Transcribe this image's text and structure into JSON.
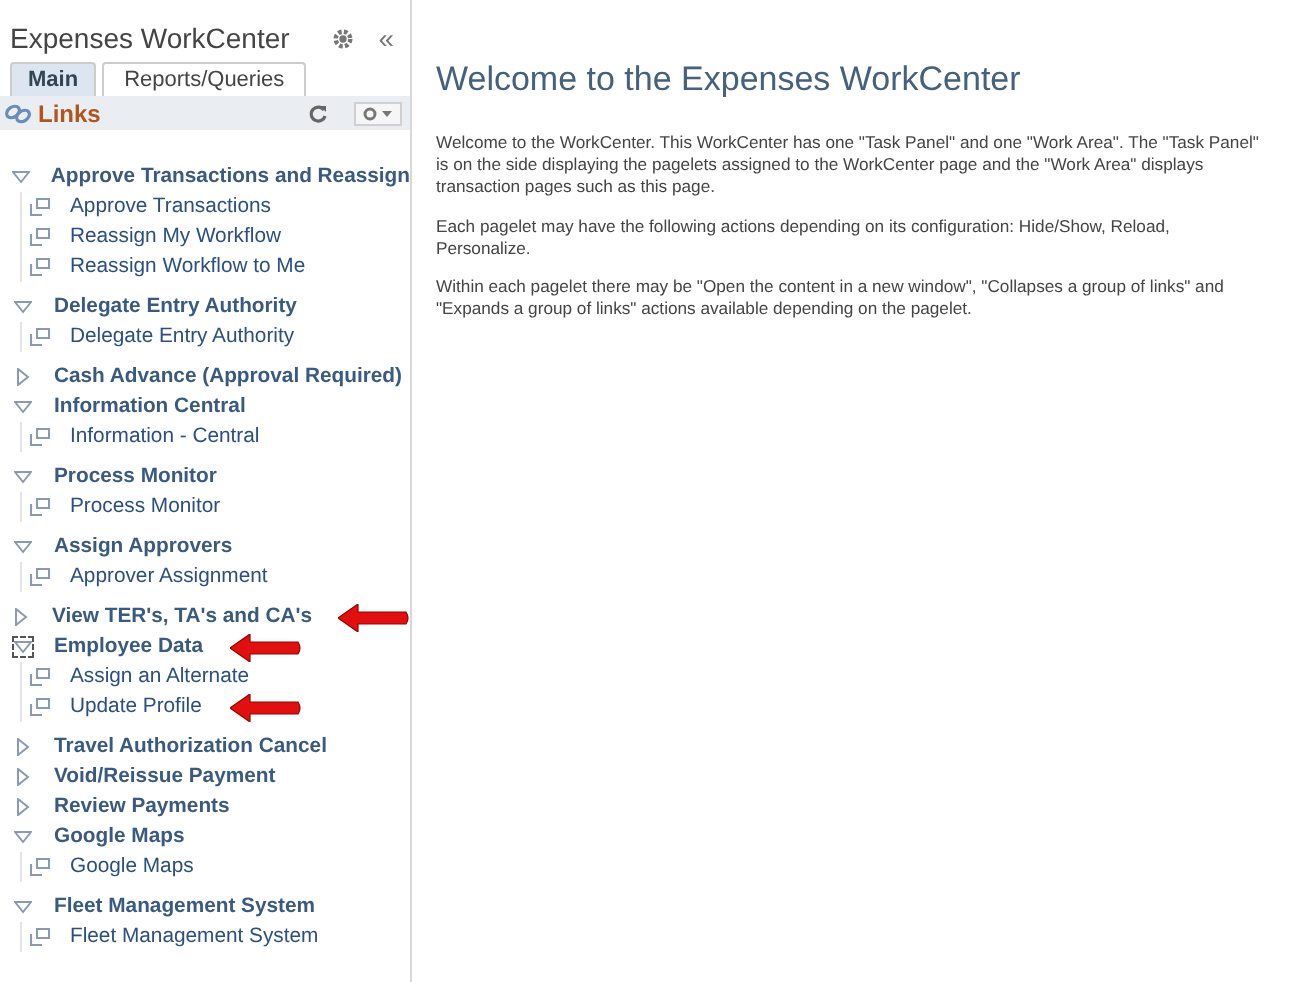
{
  "panel": {
    "title": "Expenses WorkCenter",
    "collapse_glyph": "«"
  },
  "tabs": [
    {
      "label": "Main",
      "selected": true
    },
    {
      "label": "Reports/Queries",
      "selected": false
    }
  ],
  "pagelet": {
    "title": "Links"
  },
  "groups": [
    {
      "label": "Approve Transactions and Reassign",
      "expanded": true,
      "focused": false,
      "arrow": false,
      "children": [
        {
          "label": "Approve Transactions",
          "arrow": false
        },
        {
          "label": "Reassign My Workflow",
          "arrow": false
        },
        {
          "label": "Reassign Workflow to Me",
          "arrow": false
        }
      ]
    },
    {
      "label": "Delegate Entry Authority",
      "expanded": true,
      "focused": false,
      "arrow": false,
      "children": [
        {
          "label": "Delegate Entry Authority",
          "arrow": false
        }
      ]
    },
    {
      "label": "Cash Advance (Approval Required)",
      "expanded": false,
      "focused": false,
      "arrow": false
    },
    {
      "label": "Information Central",
      "expanded": true,
      "focused": false,
      "arrow": false,
      "children": [
        {
          "label": "Information - Central",
          "arrow": false
        }
      ]
    },
    {
      "label": "Process Monitor",
      "expanded": true,
      "focused": false,
      "arrow": false,
      "children": [
        {
          "label": "Process Monitor",
          "arrow": false
        }
      ]
    },
    {
      "label": "Assign Approvers",
      "expanded": true,
      "focused": false,
      "arrow": false,
      "children": [
        {
          "label": "Approver Assignment",
          "arrow": false
        }
      ]
    },
    {
      "label": "View TER's, TA's and CA's",
      "expanded": false,
      "focused": false,
      "arrow": true
    },
    {
      "label": "Employee Data",
      "expanded": true,
      "focused": true,
      "arrow": true,
      "children": [
        {
          "label": "Assign an Alternate",
          "arrow": false
        },
        {
          "label": "Update Profile",
          "arrow": true
        }
      ]
    },
    {
      "label": "Travel Authorization Cancel",
      "expanded": false,
      "focused": false,
      "arrow": false
    },
    {
      "label": "Void/Reissue Payment",
      "expanded": false,
      "focused": false,
      "arrow": false
    },
    {
      "label": "Review Payments",
      "expanded": false,
      "focused": false,
      "arrow": false
    },
    {
      "label": "Google Maps",
      "expanded": true,
      "focused": false,
      "arrow": false,
      "children": [
        {
          "label": "Google Maps",
          "arrow": false
        }
      ]
    },
    {
      "label": "Fleet Management System",
      "expanded": true,
      "focused": false,
      "arrow": false,
      "children": [
        {
          "label": "Fleet Management System",
          "arrow": false
        }
      ]
    }
  ],
  "main": {
    "heading": "Welcome to the Expenses WorkCenter",
    "paragraphs": [
      "Welcome to the WorkCenter. This WorkCenter has one \"Task Panel\" and one \"Work Area\". The \"Task Panel\" is on the side displaying the pagelets assigned to the WorkCenter page and the \"Work Area\" displays transaction pages such as this page.",
      "Each pagelet may have the following actions depending on its configuration: Hide/Show, Reload, Personalize.",
      "Within each pagelet there may be \"Open the content in a new window\", \"Collapses a group of links\" and \"Expands a group of links\" actions available depending on the pagelet."
    ]
  }
}
